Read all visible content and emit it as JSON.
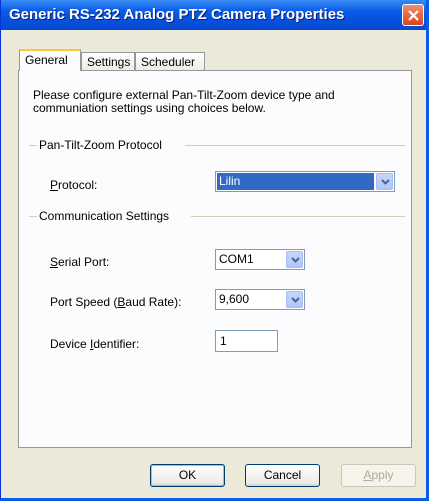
{
  "window": {
    "title": "Generic RS-232 Analog PTZ Camera Properties"
  },
  "tabs": [
    {
      "label": "General",
      "active": true
    },
    {
      "label": "Settings",
      "active": false
    },
    {
      "label": "Scheduler",
      "active": false
    }
  ],
  "general": {
    "intro": "Please configure external Pan-Tilt-Zoom device type and communiation settings using choices below.",
    "ptz_group": "Pan-Tilt-Zoom Protocol",
    "protocol": {
      "label_pre": "",
      "label_mn": "P",
      "label_post": "rotocol:",
      "value": "Lilin"
    },
    "comm_group": "Communication Settings",
    "serial_port": {
      "label_pre": "",
      "label_mn": "S",
      "label_post": "erial Port:",
      "value": "COM1"
    },
    "port_speed": {
      "label_pre": "Port Speed (",
      "label_mn": "B",
      "label_post": "aud Rate):",
      "value": "9,600"
    },
    "device_id": {
      "label_pre": "Device ",
      "label_mn": "I",
      "label_post": "dentifier:",
      "value": "1"
    }
  },
  "buttons": {
    "ok": "OK",
    "cancel": "Cancel",
    "apply_mn": "A",
    "apply_rest": "pply"
  },
  "colors": {
    "titlebar": "#0553e0",
    "selection": "#316ac5",
    "active_tab_highlight": "#ffc83c",
    "dialog_bg": "#ece9d8"
  }
}
